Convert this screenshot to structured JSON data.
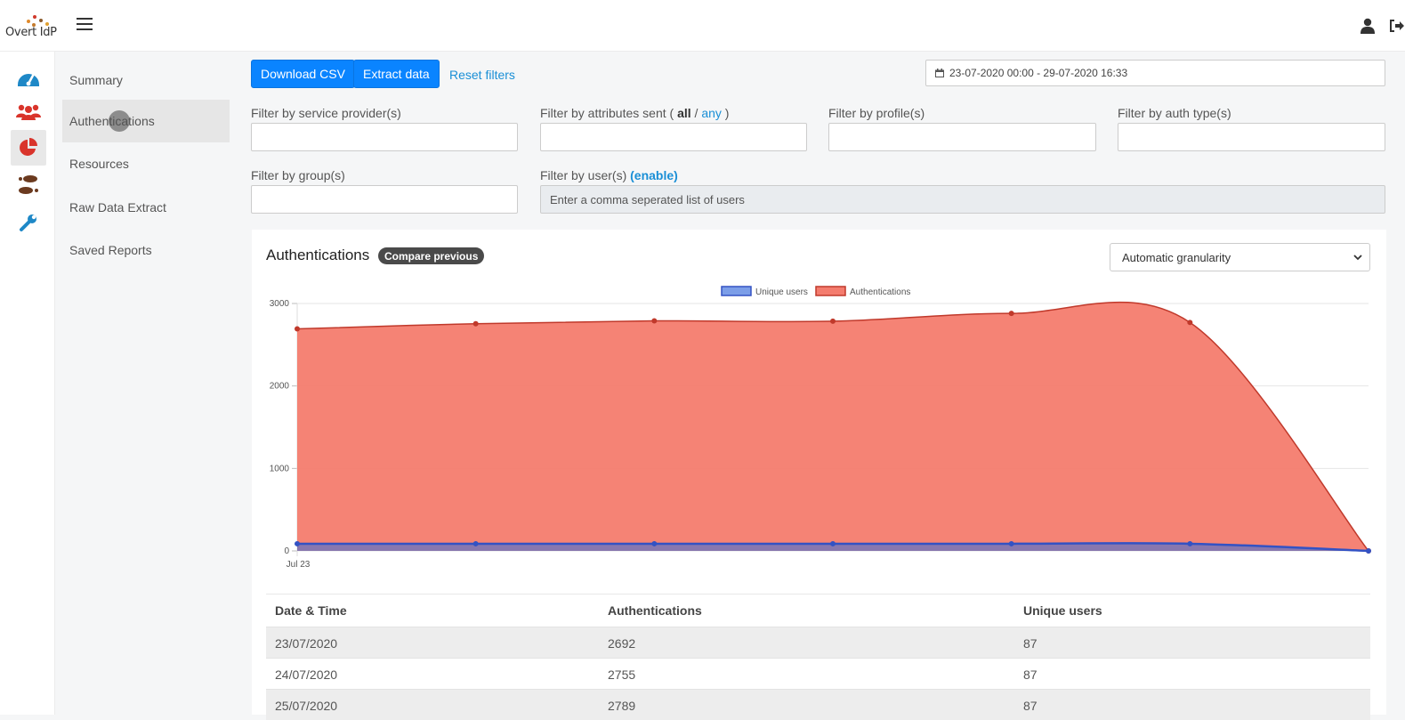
{
  "app": {
    "logo_text": "Overt IdP"
  },
  "sidebar": {
    "items": [
      {
        "label": "Summary"
      },
      {
        "label": "Authentications"
      },
      {
        "label": "Resources"
      },
      {
        "label": "Raw Data Extract"
      },
      {
        "label": "Saved Reports"
      }
    ]
  },
  "rail": {
    "icons": [
      "dashboard-icon",
      "users-icon",
      "pie-chart-icon",
      "footprints-icon",
      "wrench-icon"
    ],
    "active_icon": "pie-chart-icon"
  },
  "toolbar": {
    "download_label": "Download CSV",
    "extract_label": "Extract data",
    "reset_label": "Reset filters",
    "date_range": "23-07-2020 00:00 - 29-07-2020 16:33"
  },
  "filters": {
    "service_provider_label": "Filter by service provider(s)",
    "attributes_label_prefix": "Filter by attributes sent ( ",
    "attributes_all": "all",
    "attributes_sep": " / ",
    "attributes_any": "any",
    "attributes_suffix": " )",
    "profile_label": "Filter by profile(s)",
    "auth_type_label": "Filter by auth type(s)",
    "group_label": "Filter by group(s)",
    "user_label": "Filter by user(s)",
    "user_enable": "(enable)",
    "user_placeholder": "Enter a comma seperated list of users"
  },
  "panel": {
    "title": "Authentications",
    "compare_badge": "Compare previous",
    "granularity": "Automatic granularity"
  },
  "chart_data": {
    "type": "area",
    "legend": [
      "Unique users",
      "Authentications"
    ],
    "legend_position": "top-center",
    "x": [
      "2020-07-23",
      "2020-07-24",
      "2020-07-25",
      "2020-07-26",
      "2020-07-27",
      "2020-07-28",
      "2020-07-29"
    ],
    "x_tick_labels": [
      "Jul 23"
    ],
    "series": [
      {
        "name": "Authentications",
        "values": [
          2692,
          2755,
          2789,
          2785,
          2880,
          2770,
          0
        ],
        "color": "#f47c6e"
      },
      {
        "name": "Unique users",
        "values": [
          87,
          87,
          87,
          87,
          87,
          87,
          0
        ],
        "color": "#3d6fd6"
      }
    ],
    "y_ticks": [
      0,
      1000,
      2000,
      3000
    ],
    "ylim": [
      0,
      3000
    ],
    "grid": true
  },
  "table": {
    "headers": [
      "Date & Time",
      "Authentications",
      "Unique users"
    ],
    "rows": [
      [
        "23/07/2020",
        "2692",
        "87"
      ],
      [
        "24/07/2020",
        "2755",
        "87"
      ],
      [
        "25/07/2020",
        "2789",
        "87"
      ]
    ]
  },
  "colors": {
    "accent": "#0a84ff",
    "link": "#1a8fd6",
    "auth_fill": "#f47c6e",
    "users_line": "#3d6fd6"
  }
}
